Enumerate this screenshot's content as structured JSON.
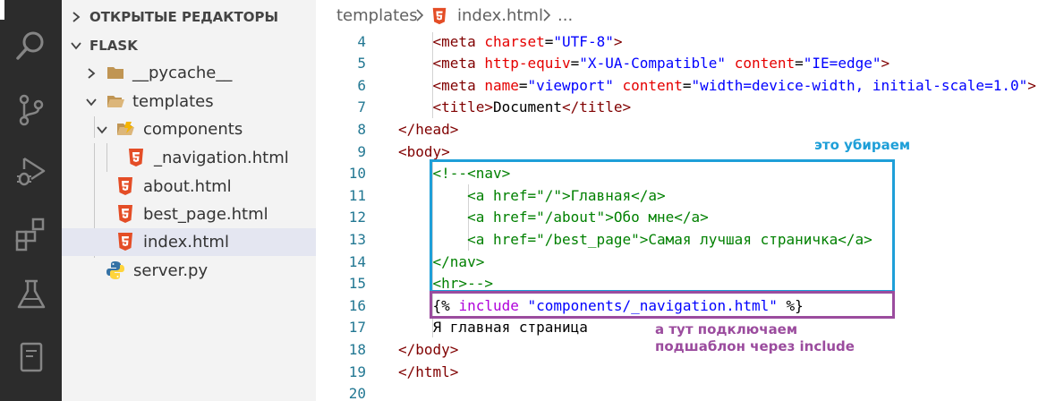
{
  "activity_bar": {
    "items": [
      {
        "name": "explorer-files-icon"
      },
      {
        "name": "search-icon"
      },
      {
        "name": "source-control-icon"
      },
      {
        "name": "run-debug-icon"
      },
      {
        "name": "extensions-icon"
      },
      {
        "name": "testing-flask-icon"
      },
      {
        "name": "notebook-icon"
      }
    ]
  },
  "sidebar": {
    "open_editors_label": "ОТКРЫТЫЕ РЕДАКТОРЫ",
    "workspace_label": "FLASK",
    "tree": [
      {
        "label": "__pycache__",
        "type": "folder",
        "expanded": false
      },
      {
        "label": "templates",
        "type": "folder",
        "expanded": true
      },
      {
        "label": "components",
        "type": "folder",
        "expanded": true
      },
      {
        "label": "_navigation.html",
        "type": "html"
      },
      {
        "label": "about.html",
        "type": "html"
      },
      {
        "label": "best_page.html",
        "type": "html"
      },
      {
        "label": "index.html",
        "type": "html",
        "selected": true
      },
      {
        "label": "server.py",
        "type": "python"
      }
    ]
  },
  "editor": {
    "breadcrumb": {
      "folder": "templates",
      "file": "index.html",
      "more": "..."
    },
    "line_numbers": [
      "4",
      "5",
      "6",
      "7",
      "8",
      "9",
      "10",
      "11",
      "12",
      "13",
      "14",
      "15",
      "16",
      "17",
      "18",
      "19",
      "20"
    ],
    "lines": [
      [
        "    ",
        "<meta ",
        "charset",
        "=",
        "\"UTF-8\"",
        ">"
      ],
      [
        "    ",
        "<meta ",
        "http-equiv",
        "=",
        "\"X-UA-Compatible\"",
        " ",
        "content",
        "=",
        "\"IE=edge\"",
        ">"
      ],
      [
        "    ",
        "<meta ",
        "name",
        "=",
        "\"viewport\"",
        " ",
        "content",
        "=",
        "\"width=device-width, initial-scale=1.0\"",
        ">"
      ],
      [
        "    ",
        "<title>",
        "Document",
        "</title>"
      ],
      [
        "",
        "</head>"
      ],
      [
        "",
        "<body>"
      ],
      [
        "    ",
        "<!--<nav>"
      ],
      [
        "        ",
        "<a href=\"/\">Главная</a>"
      ],
      [
        "        ",
        "<a href=\"/about\">Обо мне</a>"
      ],
      [
        "        ",
        "<a href=\"/best_page\">Самая лучшая страничка</a>"
      ],
      [
        "    ",
        "</nav>"
      ],
      [
        "    ",
        "<hr>-->"
      ],
      [
        "    ",
        "{% ",
        "include",
        " ",
        "\"components/_navigation.html\"",
        " %}"
      ],
      [
        "    ",
        "Я главная страница"
      ],
      [
        "",
        "</body>"
      ],
      [
        "",
        "</html>"
      ],
      [
        ""
      ]
    ]
  },
  "annotations": {
    "remove_label": "это убираем",
    "include_label_line1": "а тут подключаем",
    "include_label_line2": "подшаблон через include",
    "remove_color": "#1e9fd8",
    "include_color": "#9b4c9e"
  },
  "colors": {
    "activity_bar_bg": "#2c2c2c",
    "sidebar_bg": "#f3f3f3",
    "selected_row_bg": "#e4e6f1",
    "line_number": "#237893",
    "html_icon": "#e44d26",
    "folder_icon": "#c09553"
  }
}
